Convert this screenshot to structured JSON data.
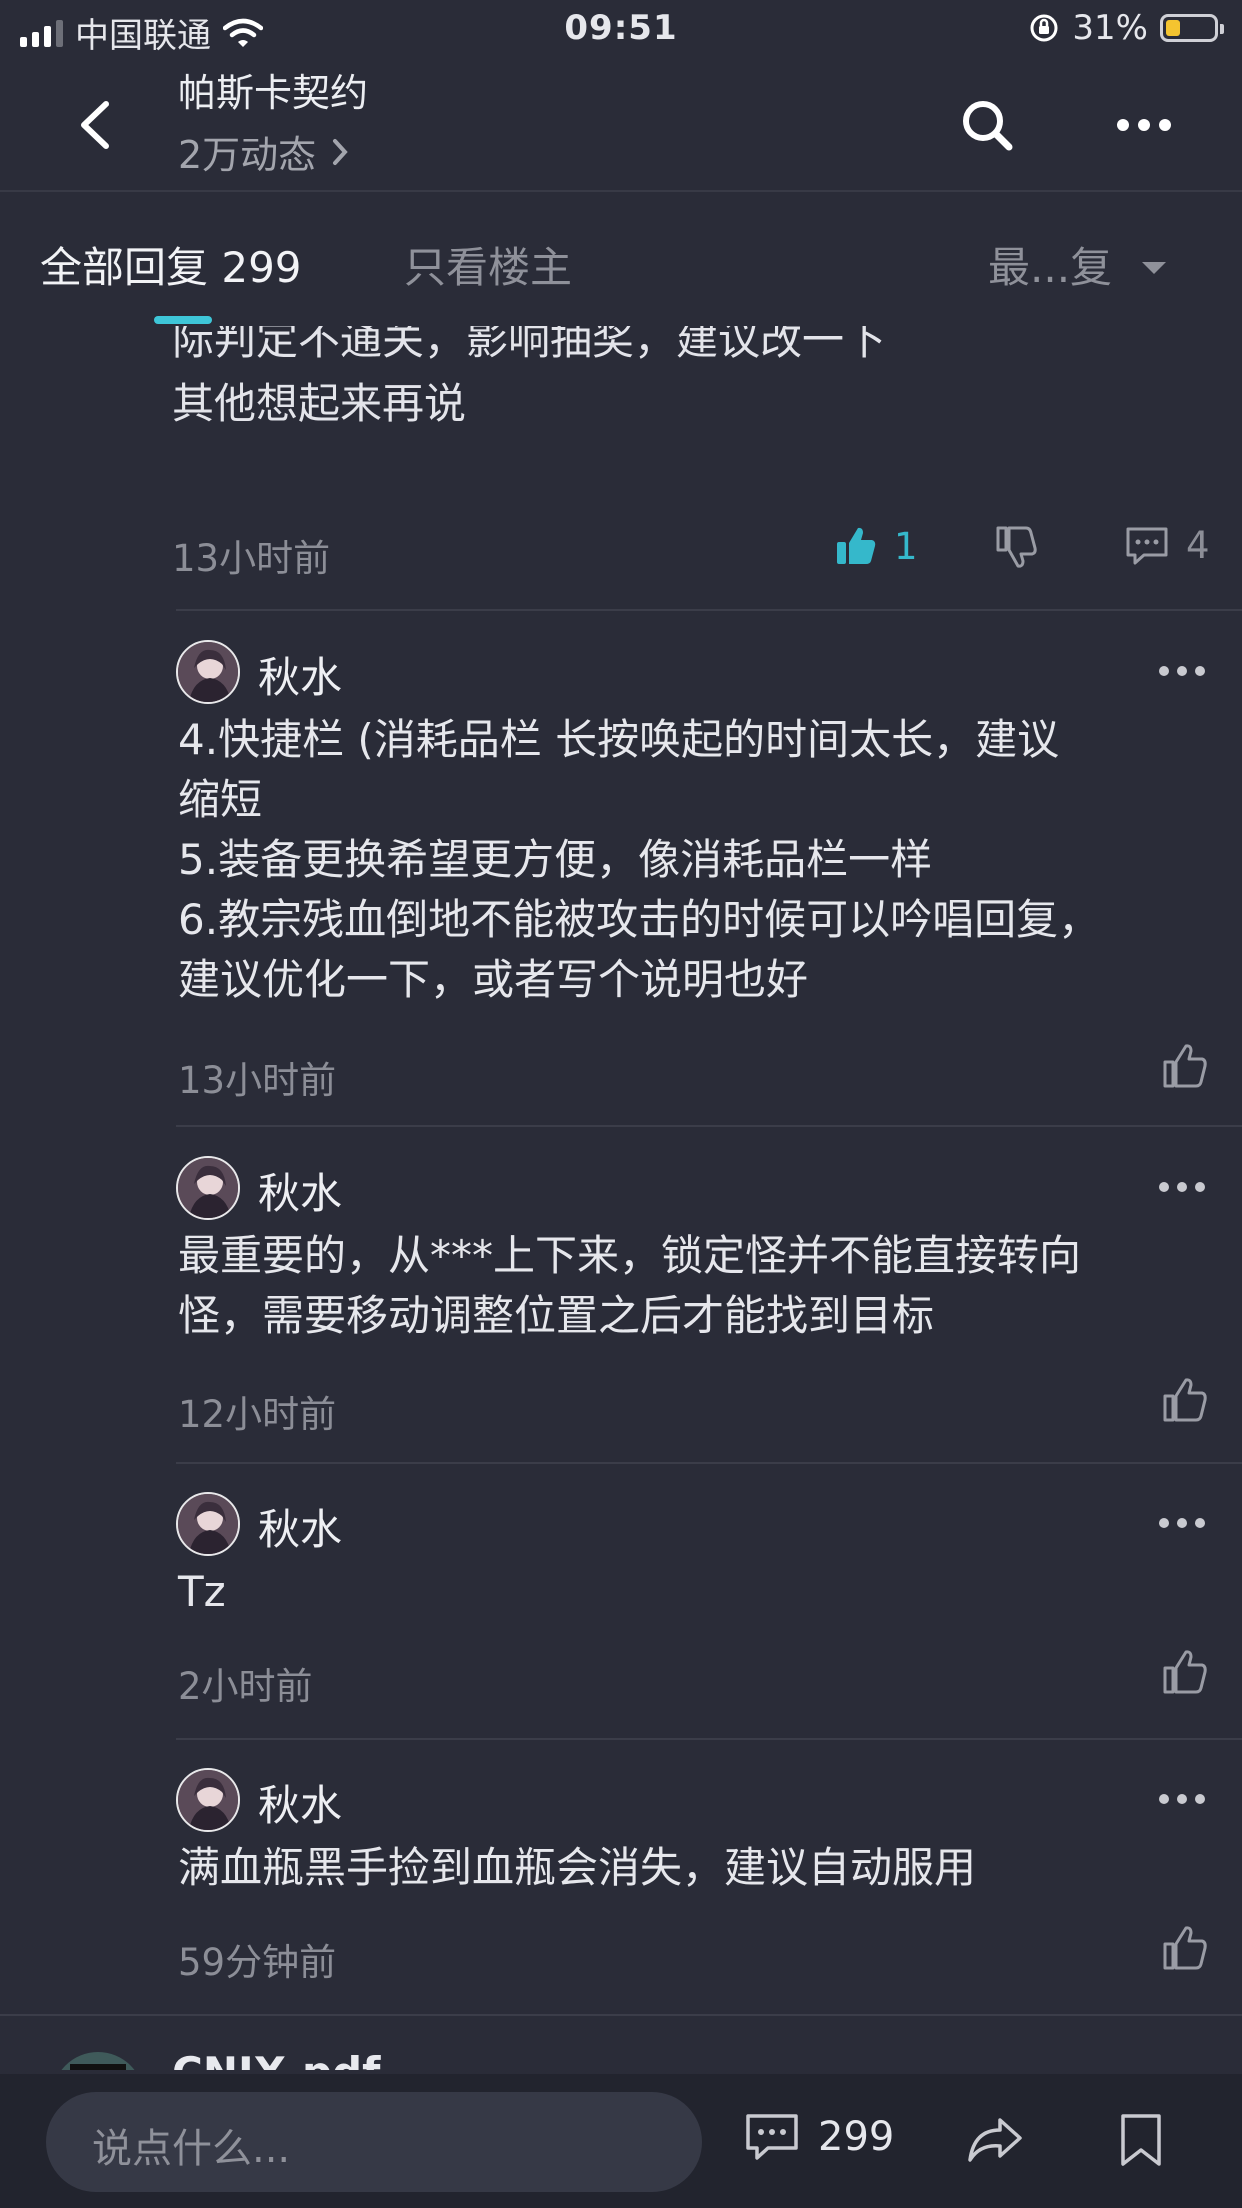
{
  "status_bar": {
    "carrier": "中国联通",
    "time": "09:51",
    "battery_percent": "31%",
    "battery_level": 0.31,
    "icons": [
      "signal-icon",
      "wifi-icon",
      "rotation-lock-icon",
      "battery-icon"
    ]
  },
  "header": {
    "title": "帕斯卡契约",
    "subtitle": "2万动态",
    "icons": [
      "back-arrow-icon",
      "chevron-right-icon",
      "search-icon",
      "more-icon"
    ]
  },
  "tabs": {
    "all_replies": "全部回复 299",
    "op_only": "只看楼主",
    "sort": "最...复",
    "accent_color": "#3ec6d8"
  },
  "previous_post": {
    "text_lines": [
      "际判定不通关，影响抽奖，建议改一下",
      "其他想起来再说"
    ],
    "time": "13小时前",
    "like_count": "1",
    "comment_count": "4"
  },
  "replies": [
    {
      "username": "秋水",
      "body_lines": [
        "4.快捷栏 (消耗品栏 长按唤起的时间太长，建议",
        "缩短",
        "5.装备更换希望更方便，像消耗品栏一样",
        "6.教宗残血倒地不能被攻击的时候可以吟唱回复，",
        "建议优化一下，或者写个说明也好"
      ],
      "time": "13小时前"
    },
    {
      "username": "秋水",
      "body_lines": [
        "最重要的，从***上下来，锁定怪并不能直接转向",
        "怪，需要移动调整位置之后才能找到目标"
      ],
      "time": "12小时前"
    },
    {
      "username": "秋水",
      "body_lines": [
        "Tz"
      ],
      "time": "2小时前"
    },
    {
      "username": "秋水",
      "body_lines": [
        "满血瓶黑手捡到血瓶会消失，建议自动服用"
      ],
      "time": "59分钟前"
    }
  ],
  "next_post": {
    "username": "CNIX.pdf"
  },
  "bottom_bar": {
    "input_placeholder": "说点什么...",
    "comment_count": "299",
    "icons": [
      "comment-icon",
      "share-icon",
      "bookmark-icon"
    ]
  }
}
